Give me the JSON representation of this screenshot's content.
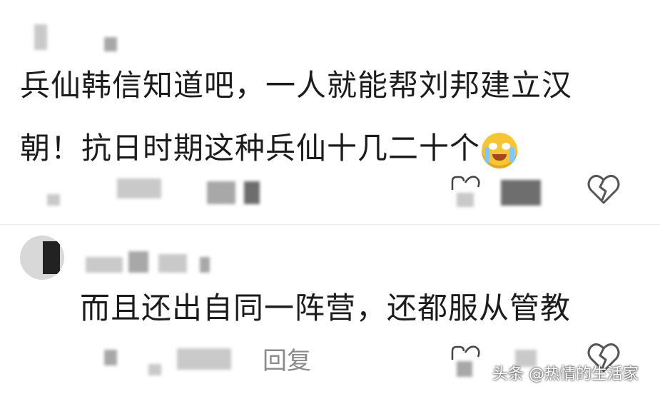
{
  "comments": [
    {
      "text_line1": "兵仙韩信知道吧，一人就能帮刘邦建立汉",
      "text_line2": "朝！抗日时期这种兵仙十几二十个",
      "emoji": "crying-laughing-emoji"
    },
    {
      "text": "而且还出自同一阵营，还都服从管教",
      "reply_label": "回复"
    }
  ],
  "watermark": "头条 @热情的生活家",
  "icons": [
    "like-icon",
    "broken-heart-icon"
  ],
  "colors": {
    "text": "#1c1c1c",
    "muted": "#8a8a8a",
    "background": "#ffffff"
  }
}
